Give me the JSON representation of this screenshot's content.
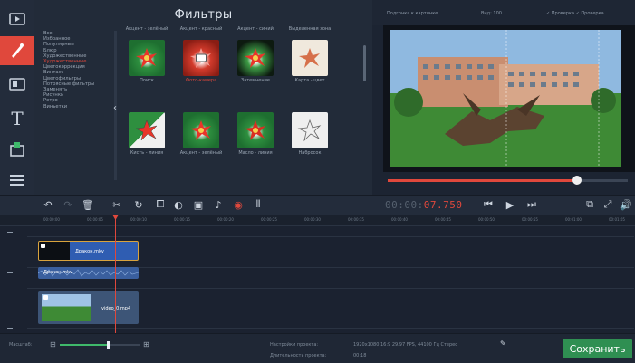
{
  "panel": {
    "title": "Фильтры",
    "categories": [
      "Все",
      "Избранное",
      "Популярные",
      "Блюр",
      "Художественные",
      "Художественные",
      "Цветокоррекция",
      "Винтаж",
      "Цветофильтры",
      "Потрясные фильтры",
      "Заменять",
      "Рисунки",
      "Ретро",
      "Виньетки"
    ],
    "active_category_index": 5,
    "thumbnails": [
      {
        "top_caption": "Акцент - зелёный",
        "caption": "Поиск",
        "style": "green"
      },
      {
        "top_caption": "Акцент - красный",
        "caption": "Фото-камера",
        "style": "red",
        "active": true
      },
      {
        "top_caption": "Акцент - синий",
        "caption": "Затемнение",
        "style": "dark"
      },
      {
        "top_caption": "Выделенная зона",
        "caption": "Карта - цвет",
        "style": "wheat"
      },
      {
        "top_caption": "",
        "caption": "Кисть - линия",
        "style": "sketch"
      },
      {
        "top_caption": "",
        "caption": "Акцент - зелёный",
        "style": "red2"
      },
      {
        "top_caption": "",
        "caption": "Масло - линия",
        "style": "red3"
      },
      {
        "top_caption": "",
        "caption": "Набросок",
        "style": "sketch2"
      }
    ]
  },
  "preview_bar": {
    "fit_label": "Подгонка к картинке",
    "zoom_label": "Вид: 100",
    "options": "✓ Проверка    ✓ Проверка"
  },
  "edit_bar": {
    "timecode_prefix": "00:00:",
    "timecode_red": "07.750"
  },
  "ruler_ticks": [
    "00:00:00",
    "00:00:05",
    "00:00:10",
    "00:00:15",
    "00:00:20",
    "00:00:25",
    "00:00:30",
    "00:00:35",
    "00:00:40",
    "00:00:45",
    "00:00:50",
    "00:00:55",
    "00:01:00",
    "00:01:05"
  ],
  "clips": {
    "overlay": "Дракон.mkv",
    "audio": "Дракон.mkv",
    "main": "video_0.mp4"
  },
  "status": {
    "zoom_label": "Масштаб:",
    "project_settings_label": "Настройки проекта:",
    "project_settings_value": "1920x1080 16:9 29.97 FPS, 44100 Гц Стерео",
    "duration_label": "Длительность проекта:",
    "duration_value": "00:18",
    "save_label": "Сохранить"
  },
  "colors": {
    "accent": "#e0483c",
    "save": "#2f8f52",
    "background": "#1c2432"
  }
}
